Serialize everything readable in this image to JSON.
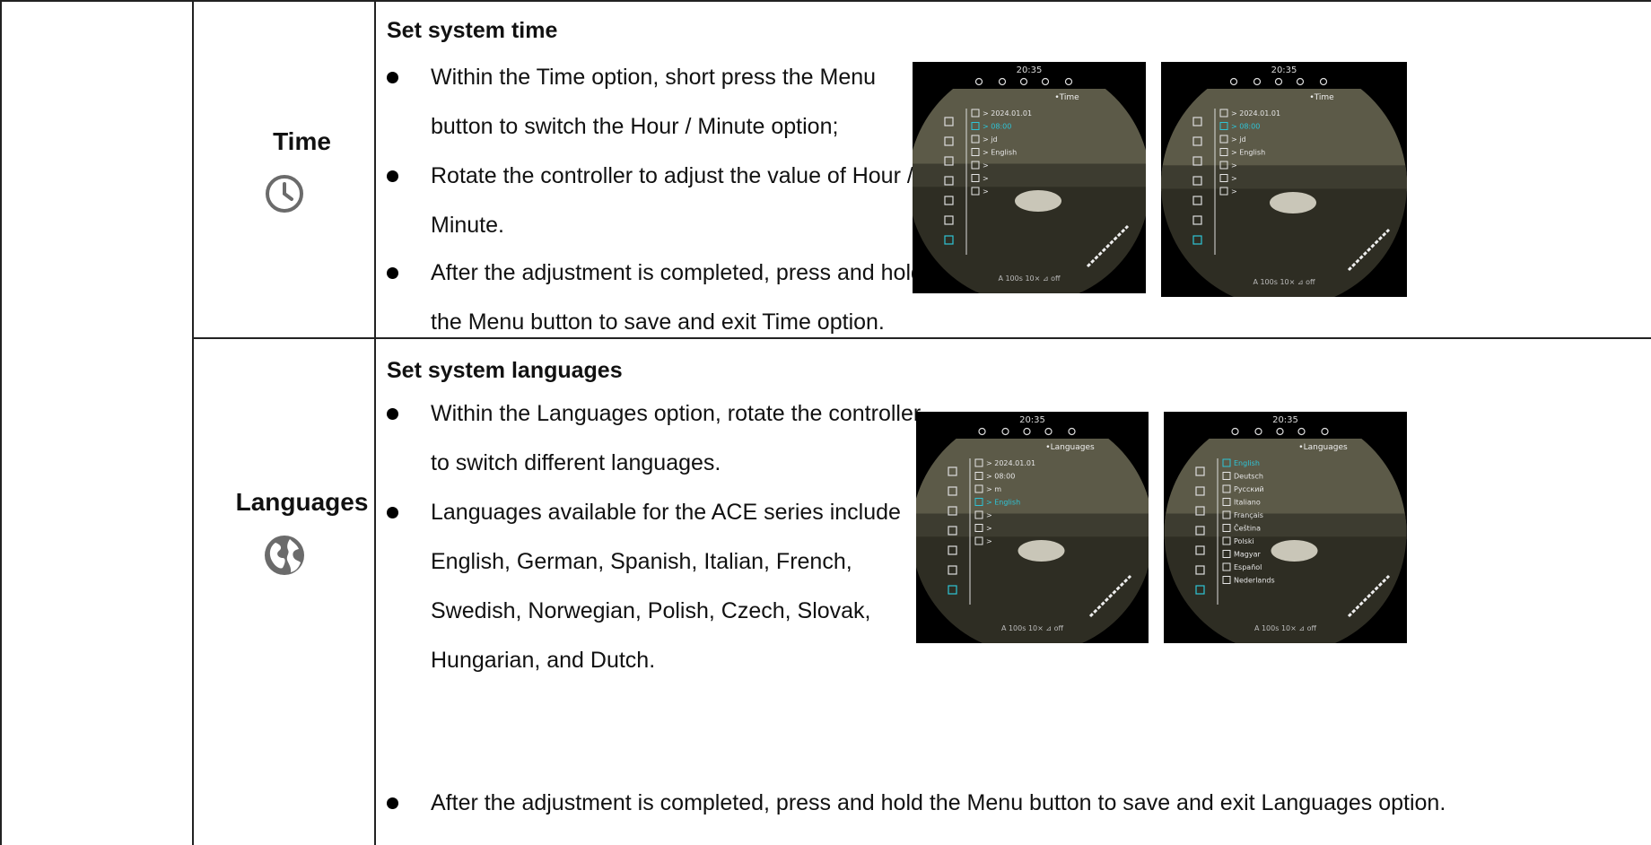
{
  "sections": [
    {
      "name": "Time",
      "icon": "clock-icon",
      "heading": "Set system time",
      "bullets": [
        [
          "Within the Time option, short press the Menu",
          "button to switch the Hour / Minute option;"
        ],
        [
          "Rotate the controller to adjust the value of Hour /",
          "Minute."
        ],
        [
          "After the adjustment is completed, press and hold",
          "the Menu button to save and exit Time option."
        ]
      ],
      "screens": [
        {
          "clock": "20:35",
          "title": "•Time",
          "items": [
            "> 2024.01.01",
            "> 08:00",
            "> jd",
            "> English",
            ">",
            ">",
            ">"
          ],
          "footer": "A 100s   10×   ⊿ off",
          "highlight": 1
        },
        {
          "clock": "20:35",
          "title": "•Time",
          "items": [
            "> 2024.01.01",
            "> 08:00",
            "> jd",
            "> English",
            ">",
            ">",
            ">"
          ],
          "footer": "A 100s   10×   ⊿ off",
          "highlight": 1
        }
      ]
    },
    {
      "name": "Languages",
      "icon": "globe-icon",
      "heading": "Set system languages",
      "bullets": [
        [
          "Within the Languages option, rotate the controller",
          "to switch different languages."
        ],
        [
          "Languages available for the ACE series include",
          "English, German, Spanish, Italian, French,",
          "Swedish, Norwegian, Polish, Czech, Slovak,",
          "Hungarian, and Dutch."
        ],
        [
          "After the adjustment is completed, press and hold the Menu button to save and exit Languages option."
        ]
      ],
      "screens": [
        {
          "clock": "20:35",
          "title": "•Languages",
          "items": [
            "> 2024.01.01",
            "> 08:00",
            "> m",
            "> English",
            ">",
            ">",
            ">"
          ],
          "footer": "A 100s   10×   ⊿ off",
          "highlight": 3
        },
        {
          "clock": "20:35",
          "title": "•Languages",
          "items": [
            "English",
            "Deutsch",
            "Русский",
            "Italiano",
            "Français",
            "Čeština",
            "Polski",
            "Magyar",
            "Español",
            "Nederlands"
          ],
          "footer": "A 100s   10×   ⊿ off",
          "highlight": 0
        }
      ]
    }
  ],
  "colors": {
    "border": "#222222",
    "highlight": "#2ec4d6",
    "scene": "#3b3a2c",
    "icon": "#6b6b6b"
  }
}
